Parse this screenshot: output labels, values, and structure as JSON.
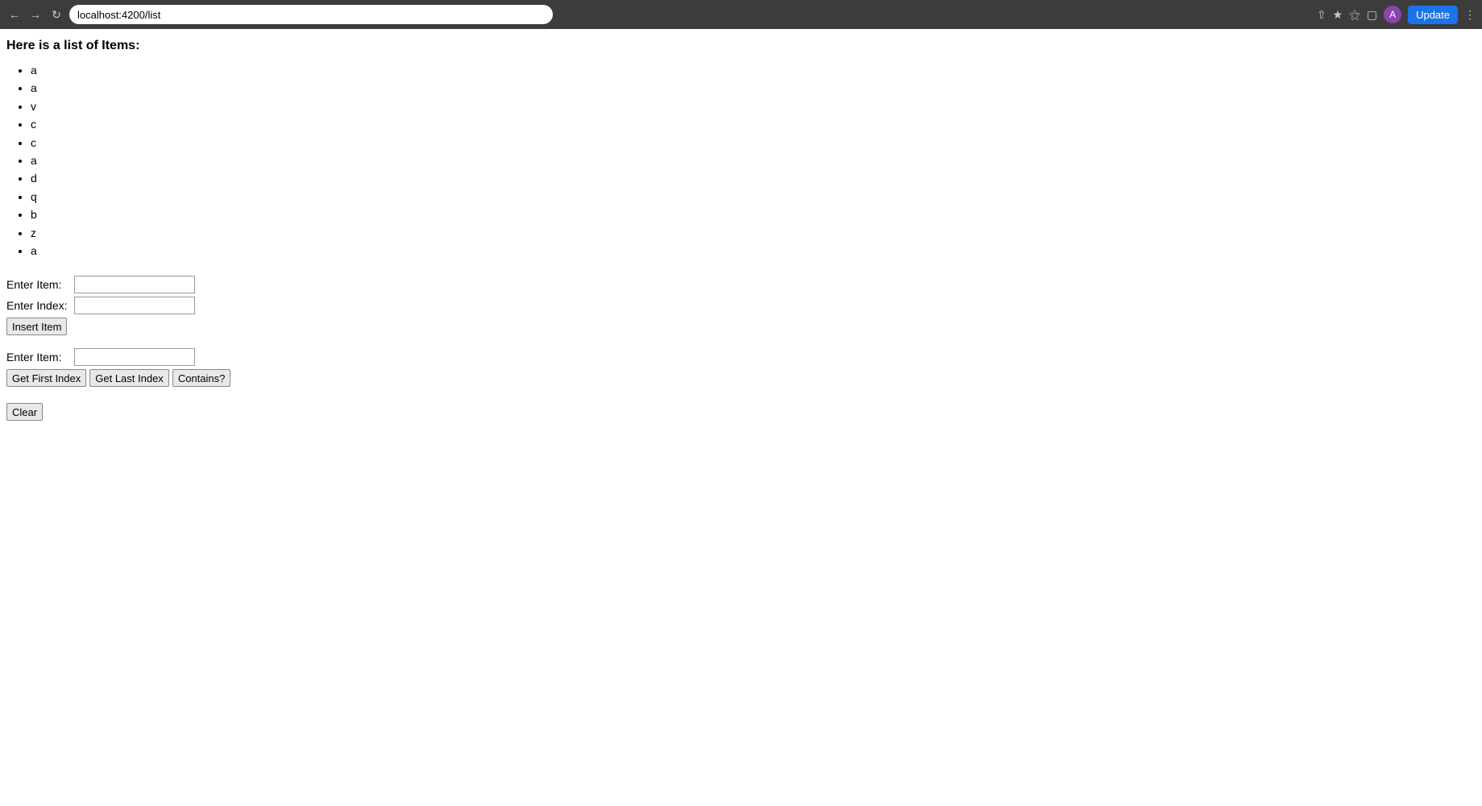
{
  "browser": {
    "url": "localhost:4200/list",
    "update_label": "Update",
    "avatar_letter": "A"
  },
  "page": {
    "title": "Here is a list of Items:",
    "items": [
      "a",
      "a",
      "v",
      "c",
      "c",
      "a",
      "d",
      "q",
      "b",
      "z",
      "a"
    ]
  },
  "insert_section": {
    "item_label": "Enter Item:",
    "index_label": "Enter Index:",
    "button_label": "Insert Item"
  },
  "search_section": {
    "item_label": "Enter Item:",
    "get_first_label": "Get First Index",
    "get_last_label": "Get Last Index",
    "contains_label": "Contains?"
  },
  "clear_section": {
    "button_label": "Clear"
  }
}
